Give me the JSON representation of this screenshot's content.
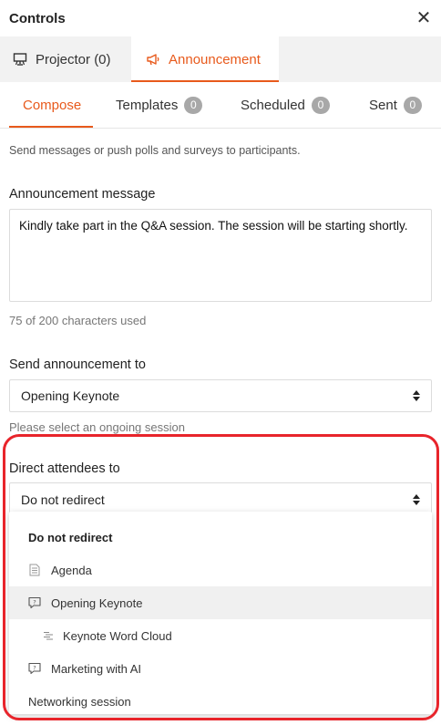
{
  "header": {
    "title": "Controls",
    "close_symbol": "✕"
  },
  "main_tabs": [
    {
      "label": "Projector (0)",
      "icon": "projector-icon"
    },
    {
      "label": "Announcement",
      "icon": "megaphone-icon"
    }
  ],
  "sub_tabs": [
    {
      "label": "Compose"
    },
    {
      "label": "Templates",
      "badge": "0"
    },
    {
      "label": "Scheduled",
      "badge": "0"
    },
    {
      "label": "Sent",
      "badge": "0"
    }
  ],
  "description": "Send messages or push polls and surveys to participants.",
  "announcement": {
    "label": "Announcement message",
    "value": "Kindly take part in the Q&A session. The session will be starting shortly.",
    "char_count": "75 of 200 characters used"
  },
  "send_to": {
    "label": "Send announcement to",
    "value": "Opening Keynote",
    "hint": "Please select an ongoing session"
  },
  "direct": {
    "label": "Direct attendees to",
    "value": "Do not redirect"
  },
  "dropdown": {
    "items": [
      {
        "label": "Do not redirect"
      },
      {
        "label": "Agenda",
        "icon": "document-icon"
      },
      {
        "label": "Opening Keynote",
        "icon": "speech-bubble-icon"
      },
      {
        "label": "Keynote Word Cloud",
        "icon": "word-cloud-icon"
      },
      {
        "label": "Marketing with AI",
        "icon": "speech-bubble-icon"
      },
      {
        "label": "Networking session"
      }
    ]
  },
  "colors": {
    "accent": "#e85a1c",
    "highlight_border": "#e8242b",
    "badge": "#a8a8a8"
  }
}
